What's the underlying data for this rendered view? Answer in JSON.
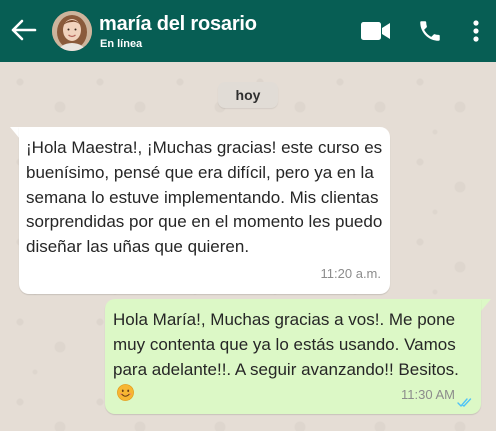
{
  "header": {
    "contact_name": "maría del rosario",
    "status": "En línea",
    "icons": [
      "back-arrow-icon",
      "video-call-icon",
      "phone-icon",
      "more-vert-icon"
    ],
    "bg_color": "#075e54"
  },
  "chat": {
    "date_chip": "hoy",
    "messages": [
      {
        "direction": "in",
        "text": "¡Hola Maestra!, ¡Muchas gracias! este curso es buenísimo, pensé que era difícil, pero ya en la semana lo estuve implementando. Mis clientas sorprendidas por que en el momento les puedo diseñar las uñas que quieren.",
        "time": "11:20 a.m.",
        "bg_color": "#ffffff"
      },
      {
        "direction": "out",
        "text": "Hola María!, Muchas gracias a vos!. Me pone muy contenta que ya lo estás usando. Vamos para adelante!!. A seguir avanzando!! Besitos.",
        "emoji": "smiling-face-emoji",
        "time": "11:30 AM",
        "read_status": "read",
        "bg_color": "#dcf8c6",
        "tick_color": "#4fc3f7"
      }
    ]
  }
}
